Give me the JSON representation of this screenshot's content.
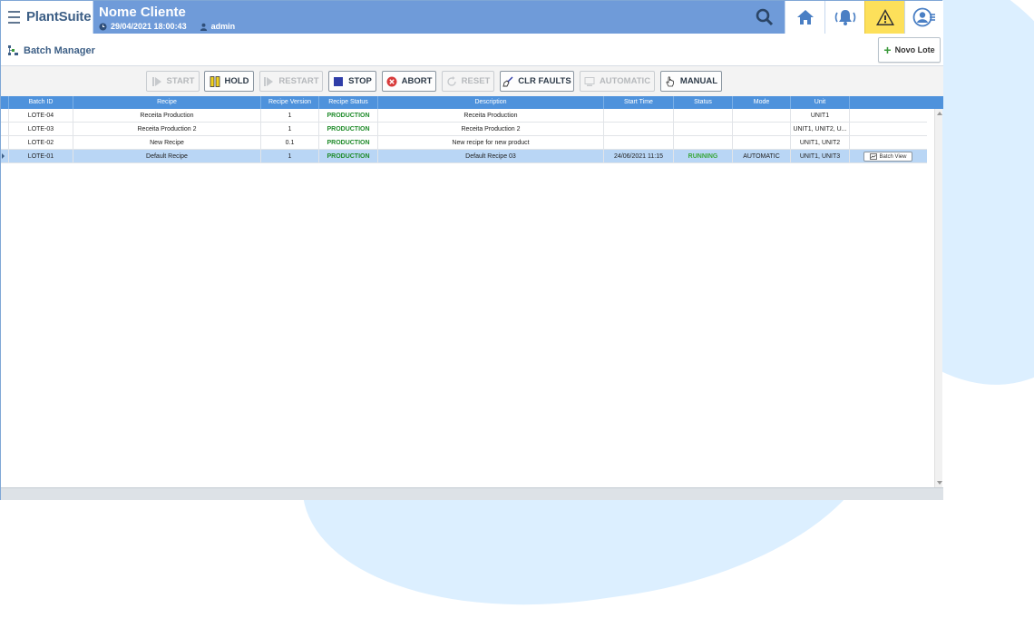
{
  "brand": {
    "name": "PlantSuite"
  },
  "header": {
    "client_name": "Nome Cliente",
    "datetime": "29/04/2021 18:00:43",
    "user": "admin"
  },
  "page": {
    "title": "Batch Manager",
    "new_button": "Novo Lote"
  },
  "toolbar": {
    "start": "START",
    "hold": "HOLD",
    "restart": "RESTART",
    "stop": "STOP",
    "abort": "ABORT",
    "reset": "RESET",
    "clr_faults": "CLR FAULTS",
    "automatic": "AUTOMATIC",
    "manual": "MANUAL"
  },
  "grid": {
    "columns": [
      "Batch ID",
      "Recipe",
      "Recipe Version",
      "Recipe Status",
      "Description",
      "Start Time",
      "Status",
      "Mode",
      "Unit"
    ],
    "rows": [
      {
        "batch_id": "LOTE-04",
        "recipe": "Receita Production",
        "version": "1",
        "recipe_status": "PRODUCTION",
        "description": "Receita Production",
        "start_time": "",
        "status": "",
        "mode": "",
        "unit": "UNIT1"
      },
      {
        "batch_id": "LOTE-03",
        "recipe": "Receita Production 2",
        "version": "1",
        "recipe_status": "PRODUCTION",
        "description": "Receita Production 2",
        "start_time": "",
        "status": "",
        "mode": "",
        "unit": "UNIT1, UNIT2, U..."
      },
      {
        "batch_id": "LOTE-02",
        "recipe": "New Recipe",
        "version": "0.1",
        "recipe_status": "PRODUCTION",
        "description": "New recipe for new product",
        "start_time": "",
        "status": "",
        "mode": "",
        "unit": "UNIT1, UNIT2"
      },
      {
        "batch_id": "LOTE-01",
        "recipe": "Default Recipe",
        "version": "1",
        "recipe_status": "PRODUCTION",
        "description": "Default Recipe 03",
        "start_time": "24/06/2021 11:15",
        "status": "RUNNING",
        "mode": "AUTOMATIC",
        "unit": "UNIT1, UNIT3"
      }
    ],
    "batch_view_label": "Batch View"
  },
  "colors": {
    "header": "#6f9bd9",
    "grid_header": "#4e92dc",
    "selected_row": "#b9d6f5",
    "production": "#1f8b2a",
    "running": "#3aa63a",
    "warning": "#fde05a"
  },
  "icons": [
    "hamburger-icon",
    "clock-icon",
    "user-icon",
    "search-icon",
    "home-icon",
    "bell-icon",
    "warning-icon",
    "user-menu-icon",
    "batch-icon",
    "plus-icon",
    "play-icon",
    "pause-icon",
    "stop-icon",
    "abort-icon",
    "reset-icon",
    "clear-faults-icon",
    "automatic-icon",
    "manual-icon",
    "batch-view-icon"
  ]
}
